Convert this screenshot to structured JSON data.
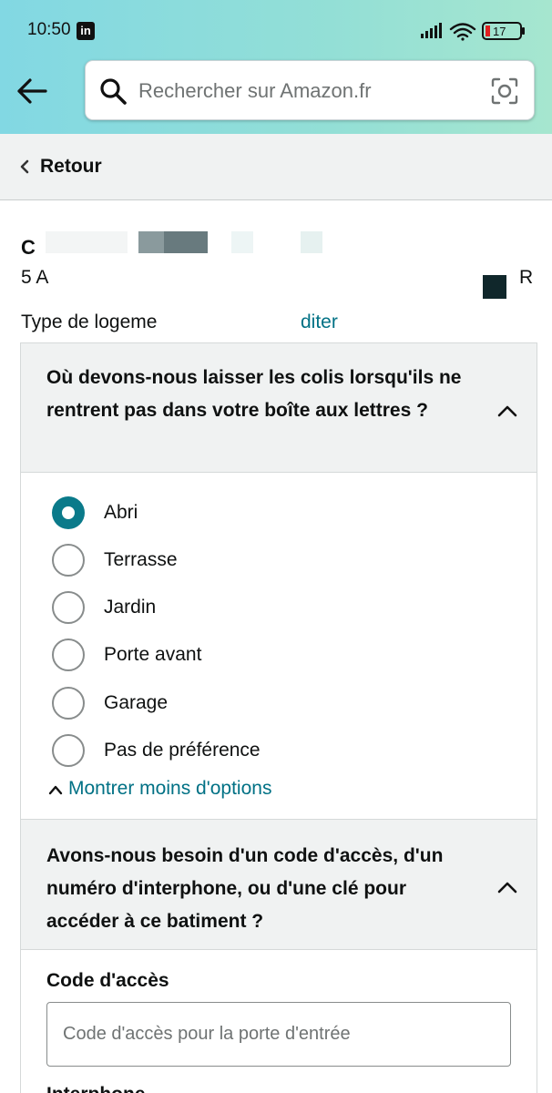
{
  "status_bar": {
    "time": "10:50",
    "app_badge": "in",
    "battery": "17"
  },
  "search": {
    "placeholder": "Rechercher sur Amazon.fr"
  },
  "nav": {
    "back_label": "Retour"
  },
  "address": {
    "line1": "C",
    "line2_start": "5 A",
    "line2_end": "R"
  },
  "housing": {
    "label_visible": "Type de logeme",
    "link_visible": "diter"
  },
  "delivery_location": {
    "question": "Où devons-nous laisser les colis lorsqu'ils ne rentrent pas dans votre boîte aux lettres ?",
    "options": [
      {
        "label": "Abri",
        "selected": true
      },
      {
        "label": "Terrasse",
        "selected": false
      },
      {
        "label": "Jardin",
        "selected": false
      },
      {
        "label": "Porte avant",
        "selected": false
      },
      {
        "label": "Garage",
        "selected": false
      },
      {
        "label": "Pas de préférence",
        "selected": false
      }
    ],
    "toggle_label": "Montrer moins d'options"
  },
  "access": {
    "question": "Avons-nous besoin d'un code d'accès, d'un numéro d'interphone, ou d'une clé pour accéder à ce batiment ?",
    "code_label": "Code d'accès",
    "code_placeholder": "Code d'accès pour la porte d'entrée",
    "code_value": "",
    "next_label": "Interphone"
  },
  "colors": {
    "header_gradient_start": "#82d8e3",
    "header_gradient_end": "#a6e6cf",
    "link": "#007185",
    "radio_selected": "#0a7a8a",
    "battery_low": "#e02020"
  }
}
